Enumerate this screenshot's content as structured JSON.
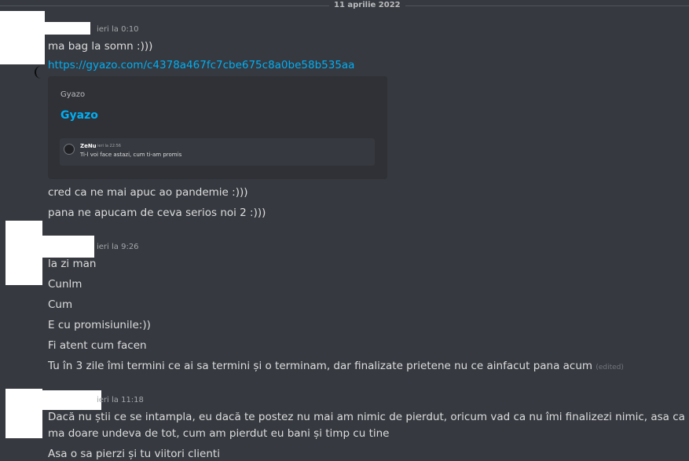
{
  "date_divider": "11 aprilie 2022",
  "messages": [
    {
      "timestamp": "ieri la 0:10",
      "lines": [
        "ma bag la somn :)))"
      ],
      "link": "https://gyazo.com/c4378a467fc7cbe675c8a0be58b535aa",
      "embed": {
        "provider": "Gyazo",
        "title": "Gyazo",
        "preview": {
          "author": "ZeNu",
          "time": "ieri la 22:56",
          "text": "Ti-l voi face astazi, cum ti-am promis"
        }
      },
      "after_lines": [
        "cred ca ne  mai apuc ao pandemie :)))",
        "pana ne apucam de ceva serios noi 2 :)))"
      ]
    },
    {
      "timestamp": "ieri la 9:26",
      "lines": [
        "la zi man",
        "Cunlm",
        "Cum",
        "E cu promisiunile:))",
        "Fi atent cum facen",
        "Tu în 3 zile îmi termini ce ai sa termini și o terminam, dar finalizate prietene nu ce ainfacut pana acum"
      ],
      "edited_label": "(edited)"
    },
    {
      "timestamp": "ieri la 11:18",
      "lines": [
        "Dacă nu știi ce se intampla, eu dacă te postez nu mai am nimic de pierdut, oricum  vad ca nu îmi finalizezi nimic, asa ca ma doare undeva de tot, cum am pierdut eu bani și timp cu tine",
        "Asa o sa pierzi și tu viitori clienti"
      ]
    }
  ],
  "colors": {
    "background": "#36393f",
    "text": "#dcddde",
    "link": "#00aff4",
    "embed_bg": "#2f3136",
    "muted": "#a3a6aa"
  }
}
